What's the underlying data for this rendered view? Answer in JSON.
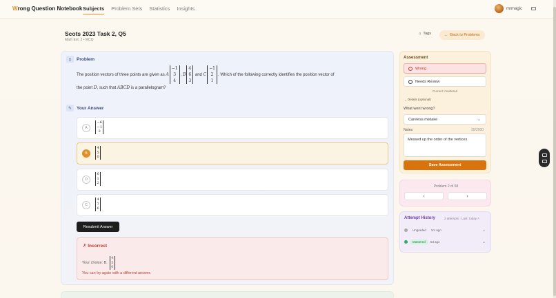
{
  "nav": {
    "brand_letter": "W",
    "brand_rest": "rong Question Notebook",
    "links": [
      "Subjects",
      "Problem Sets",
      "Statistics",
      "Insights"
    ],
    "user": "mrmagic"
  },
  "header": {
    "title": "Scots 2023 Task 2, Q5",
    "subtitle": "Math Ext. 2 • MCQ",
    "tags_label": "Tags",
    "back_label": "Back to Problems"
  },
  "problem": {
    "heading": "Problem",
    "t1": "The position vectors of three points are given as ",
    "A": "A",
    "vecA": [
      "−1",
      "3",
      "4"
    ],
    "B": "B",
    "vecB": [
      "4",
      "6",
      "3"
    ],
    "and": " and ",
    "C": "C",
    "vecC": [
      "−1",
      "2",
      "1"
    ],
    "t2": ". Which of the following correctly identifies the position vector of",
    "t3": "the point ",
    "D": "D",
    "t4": ", such that ",
    "ABCD": "ABCD",
    "t5": " is a parallelogram?"
  },
  "answer": {
    "heading": "Your Answer",
    "options": [
      {
        "letter": "A",
        "v": [
          "−6",
          "−1",
          "2"
        ]
      },
      {
        "letter": "B",
        "v": [
          "4",
          "5",
          "0"
        ]
      },
      {
        "letter": "D",
        "v": [
          "6",
          "1",
          "2"
        ]
      },
      {
        "letter": "C",
        "v": [
          "4",
          "7",
          "6"
        ]
      }
    ],
    "resubmit_label": "Resubmit Answer"
  },
  "result": {
    "heading": "✗  Incorrect",
    "choice_label": "Your choice: B.",
    "choice_vec": [
      "4",
      "5",
      "0"
    ],
    "retry": "You can try again with a different answer."
  },
  "assessment": {
    "heading": "Assessment",
    "wrong_label": "Wrong",
    "review_label": "Needs Review",
    "current": "Current: mastered",
    "details": "Details (optional)",
    "what_label": "What went wrong?",
    "what_value": "Careless mistake",
    "notes_label": "Notes",
    "notes_count": "35/2000",
    "notes_value": "Messed up the order of the vertices",
    "save_label": "Save Assessment"
  },
  "pager": {
    "text": "Problem 2 of 58",
    "prev": "‹",
    "next": "›"
  },
  "history": {
    "heading": "Attempt History",
    "meta": "2 attempts · Last: today",
    "rows": [
      {
        "status": "Ungraded",
        "when": "1m ago"
      },
      {
        "status": "Mastered",
        "when": "5d ago"
      }
    ]
  },
  "colors": {
    "accent": "#e0902a",
    "wrong": "#c0392b",
    "mastered": "#27ae60"
  }
}
